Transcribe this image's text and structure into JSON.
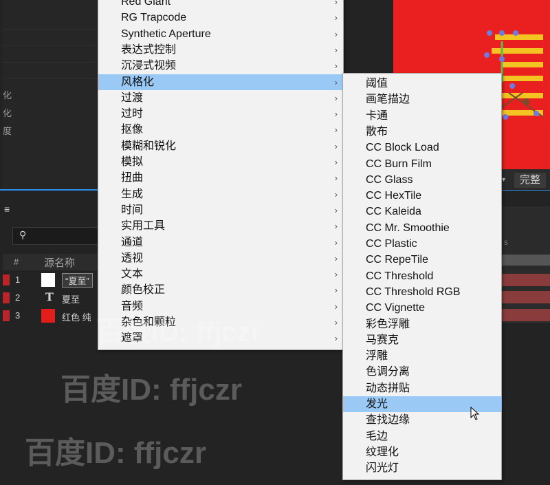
{
  "background": {
    "left_panel_labels": [
      "化",
      "化",
      "度"
    ],
    "column_headers": {
      "hash": "#",
      "source_name": "源名称"
    },
    "layers": [
      {
        "num": "1",
        "name": "“夏至”",
        "swatch": "#ffffff"
      },
      {
        "num": "2",
        "name": "夏至",
        "type_glyph": "T"
      },
      {
        "num": "3",
        "name": "红色 纯",
        "swatch": "#e31c1c"
      }
    ],
    "right_toolbar_button": "完整",
    "right_s": "s",
    "watermark": "百度ID: ffjczr"
  },
  "menu_effects": {
    "items": [
      {
        "label": "Red Giant"
      },
      {
        "label": "RG Trapcode"
      },
      {
        "label": "Synthetic Aperture"
      },
      {
        "label": "表达式控制"
      },
      {
        "label": "沉浸式视频"
      },
      {
        "label": "风格化",
        "highlighted": true
      },
      {
        "label": "过渡"
      },
      {
        "label": "过时"
      },
      {
        "label": "抠像"
      },
      {
        "label": "模糊和锐化"
      },
      {
        "label": "模拟"
      },
      {
        "label": "扭曲"
      },
      {
        "label": "生成"
      },
      {
        "label": "时间"
      },
      {
        "label": "实用工具"
      },
      {
        "label": "通道"
      },
      {
        "label": "透视"
      },
      {
        "label": "文本"
      },
      {
        "label": "颜色校正"
      },
      {
        "label": "音频"
      },
      {
        "label": "杂色和颗粒"
      },
      {
        "label": "遮罩"
      }
    ],
    "arrow": "›"
  },
  "menu_stylize": {
    "items": [
      {
        "label": "阈值"
      },
      {
        "label": "画笔描边"
      },
      {
        "label": "卡通"
      },
      {
        "label": "散布"
      },
      {
        "label": "CC Block Load"
      },
      {
        "label": "CC Burn Film"
      },
      {
        "label": "CC Glass"
      },
      {
        "label": "CC HexTile"
      },
      {
        "label": "CC Kaleida"
      },
      {
        "label": "CC Mr. Smoothie"
      },
      {
        "label": "CC Plastic"
      },
      {
        "label": "CC RepeTile"
      },
      {
        "label": "CC Threshold"
      },
      {
        "label": "CC Threshold RGB"
      },
      {
        "label": "CC Vignette"
      },
      {
        "label": "彩色浮雕"
      },
      {
        "label": "马赛克"
      },
      {
        "label": "浮雕"
      },
      {
        "label": "色调分离"
      },
      {
        "label": "动态拼贴"
      },
      {
        "label": "发光",
        "highlighted": true
      },
      {
        "label": "查找边缘"
      },
      {
        "label": "毛边"
      },
      {
        "label": "纹理化"
      },
      {
        "label": "闪光灯"
      }
    ]
  },
  "colors": {
    "highlight": "#99c9f4",
    "menu_bg": "#f2f2f2",
    "preview_red": "#e9201f",
    "accent_blue": "#2d8ceb"
  }
}
